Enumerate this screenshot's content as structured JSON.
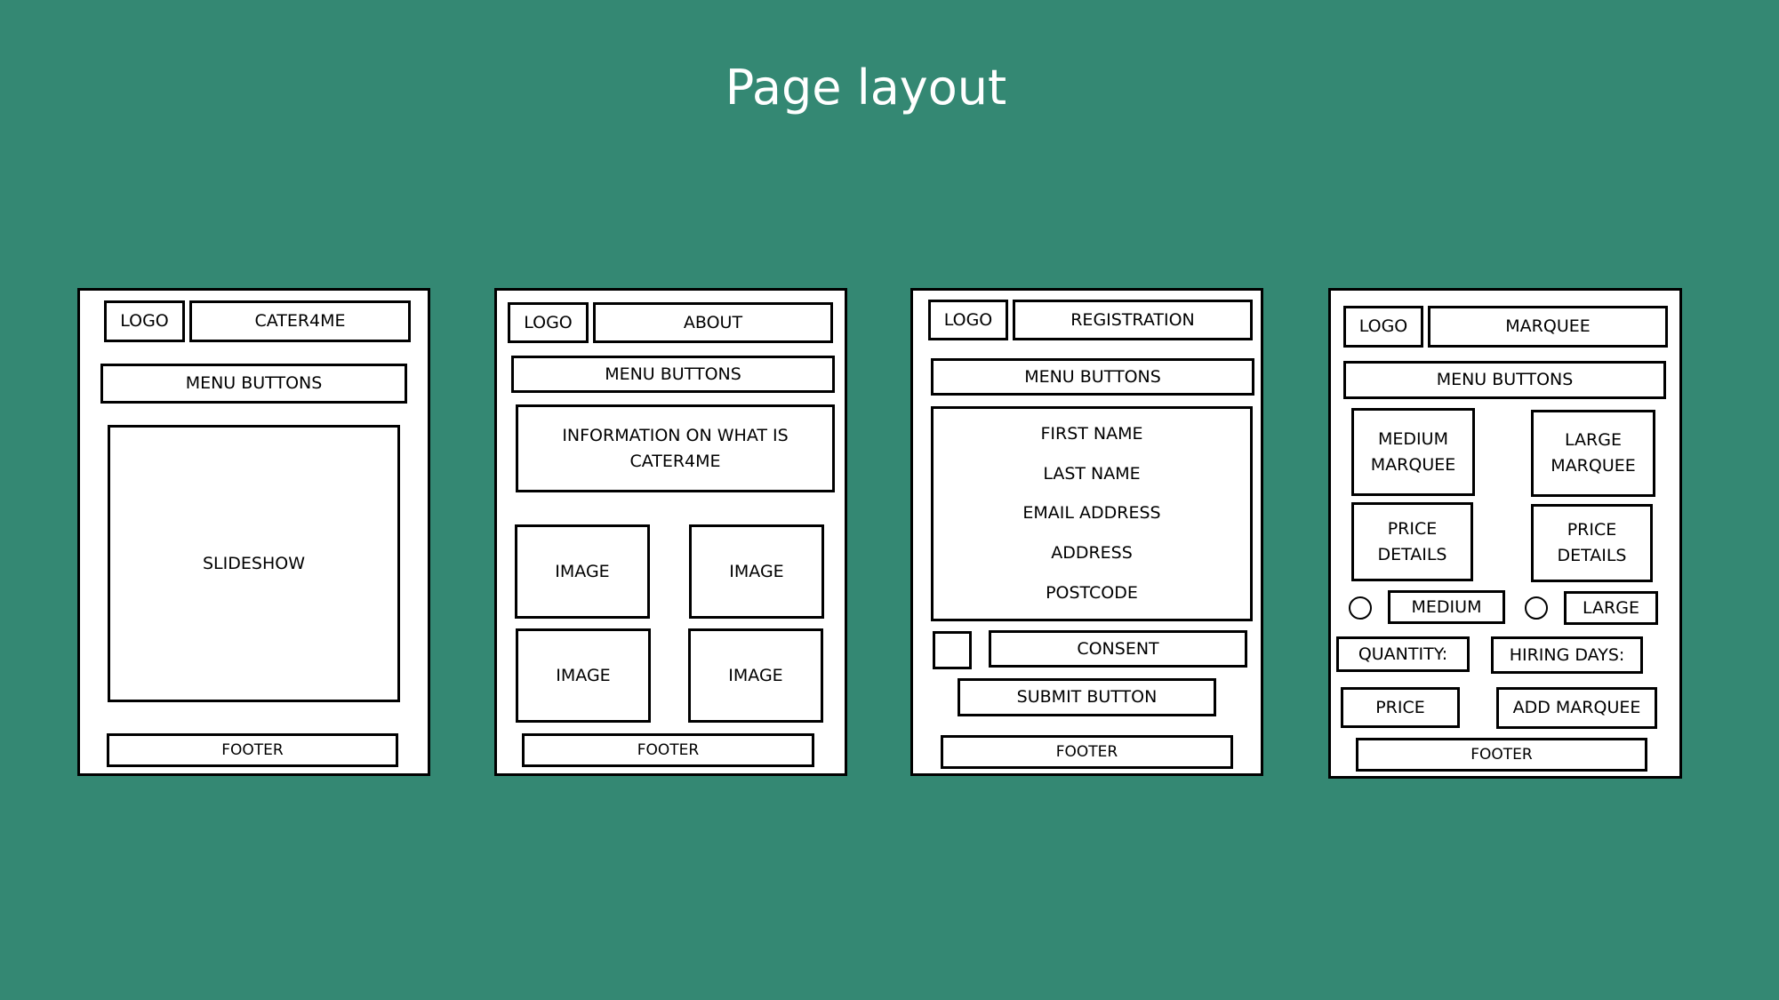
{
  "title": "Page layout",
  "colors": {
    "background": "#348873",
    "frame": "#ffffff",
    "stroke": "#000000",
    "title_text": "#ffffff"
  },
  "wireframes": [
    {
      "name": "home",
      "logo": "LOGO",
      "page_title": "CATER4ME",
      "menu": "MENU BUTTONS",
      "slideshow": "SLIDESHOW",
      "footer": "FOOTER"
    },
    {
      "name": "about",
      "logo": "LOGO",
      "page_title": "ABOUT",
      "menu": "MENU BUTTONS",
      "info": "INFORMATION ON WHAT IS CATER4ME",
      "images": [
        "IMAGE",
        "IMAGE",
        "IMAGE",
        "IMAGE"
      ],
      "footer": "FOOTER"
    },
    {
      "name": "registration",
      "logo": "LOGO",
      "page_title": "REGISTRATION",
      "menu": "MENU BUTTONS",
      "fields": [
        "FIRST NAME",
        "LAST NAME",
        "EMAIL ADDRESS",
        "ADDRESS",
        "POSTCODE"
      ],
      "consent": "CONSENT",
      "submit": "SUBMIT BUTTON",
      "footer": "FOOTER"
    },
    {
      "name": "marquee",
      "logo": "LOGO",
      "page_title": "MARQUEE",
      "menu": "MENU BUTTONS",
      "medium_marquee": "MEDIUM MARQUEE",
      "large_marquee": "LARGE MARQUEE",
      "price_details_medium": "PRICE DETAILS",
      "price_details_large": "PRICE DETAILS",
      "option_medium": "MEDIUM",
      "option_large": "LARGE",
      "quantity": "QUANTITY:",
      "hiring_days": "HIRING DAYS:",
      "price": "PRICE",
      "add_marquee": "ADD MARQUEE",
      "footer": "FOOTER"
    }
  ]
}
